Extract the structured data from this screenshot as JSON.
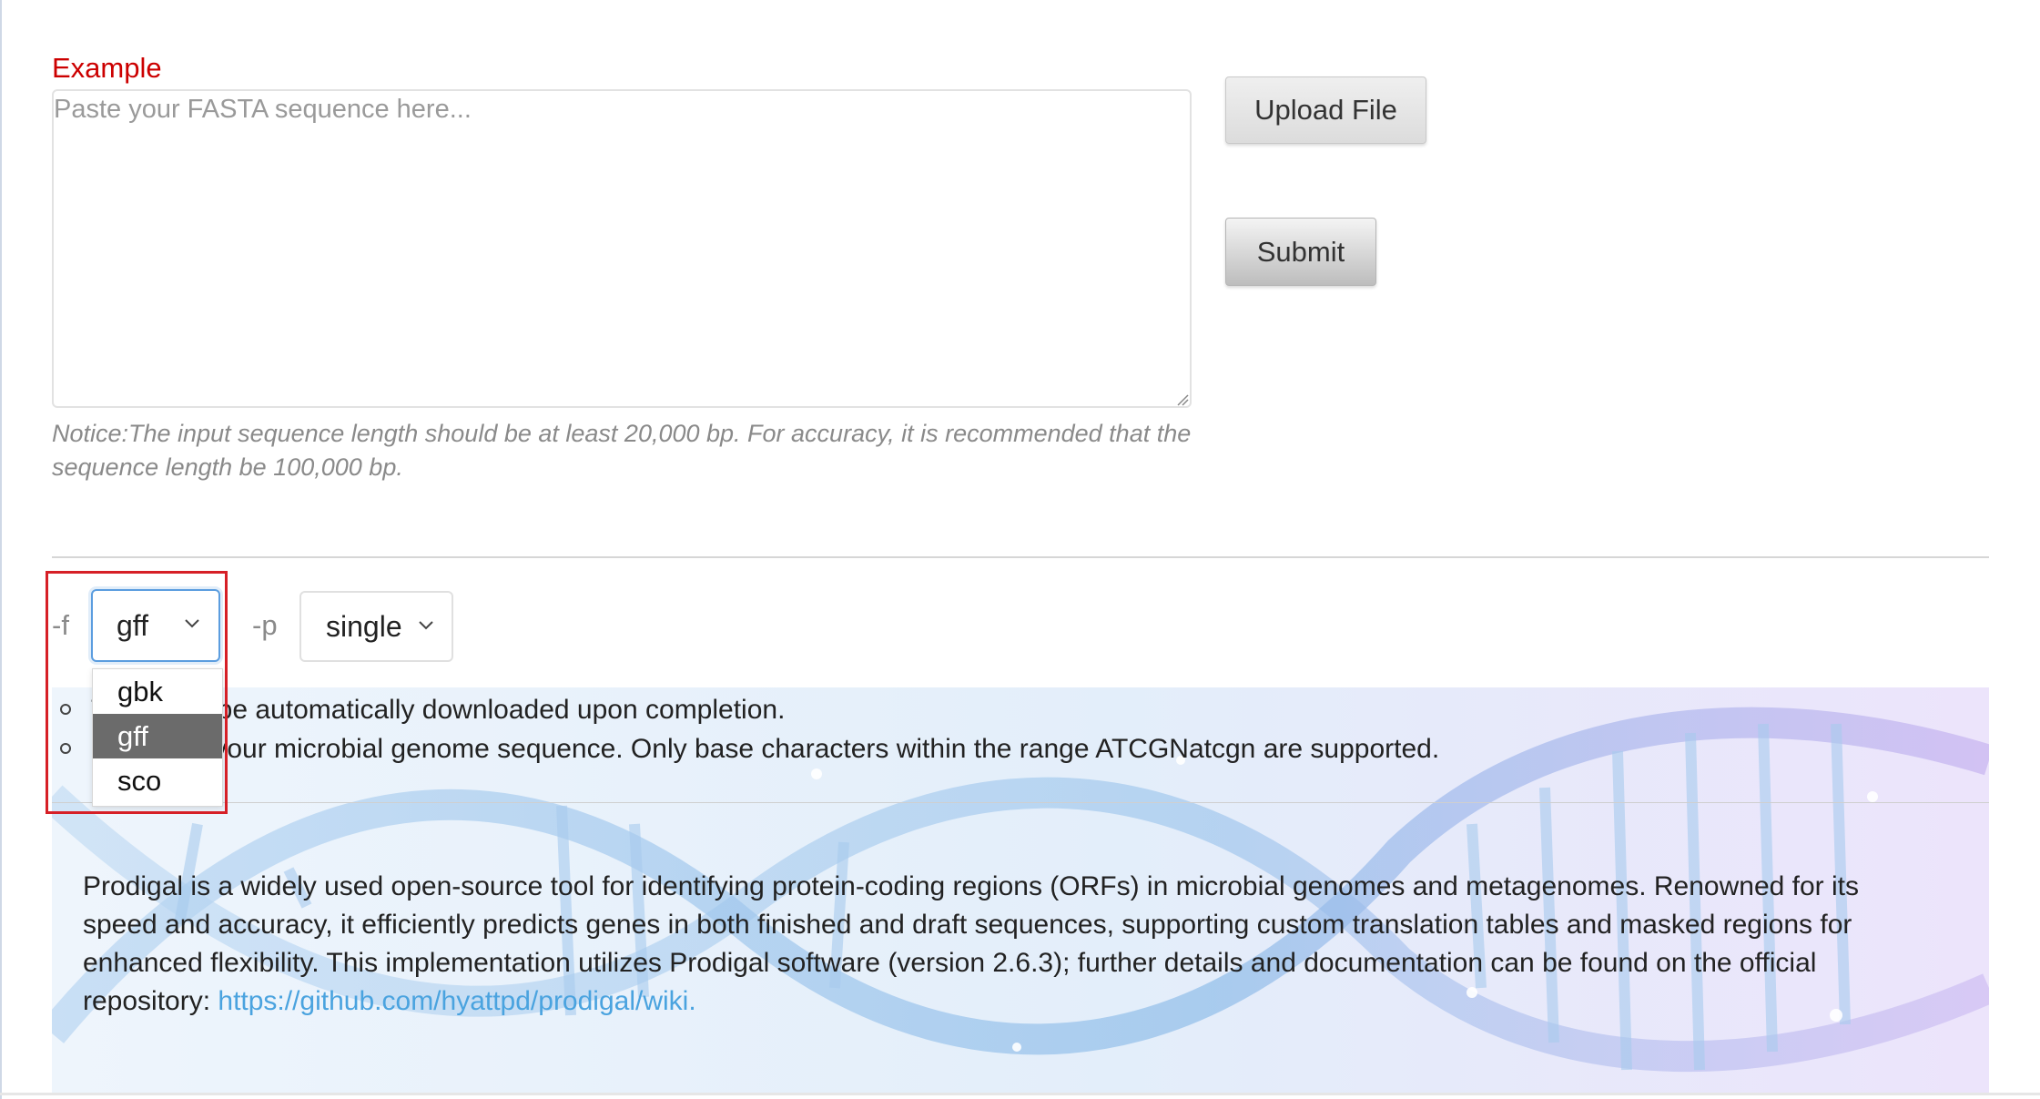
{
  "form": {
    "example_label": "Example",
    "textarea_placeholder": "Paste your FASTA sequence here...",
    "upload_label": "Upload File",
    "submit_label": "Submit",
    "notice_line1": "Notice:The input sequence length should be at least 20,000 bp. For accuracy, it is recommended that the",
    "notice_line2": "sequence length be 100,000 bp."
  },
  "options": {
    "f_label": "-f",
    "f_value": "gff",
    "f_options": [
      "gbk",
      "gff",
      "sco"
    ],
    "f_selected_index": 1,
    "p_label": "-p",
    "p_value": "single"
  },
  "bullets": {
    "b1_visible": "ile will be automatically downloaded upon completion.",
    "b2_visible": "r your microbial genome sequence. Only base characters within the range ATCGNatcgn are supported."
  },
  "description": {
    "text": "Prodigal is a widely used open-source tool for identifying protein-coding regions (ORFs) in microbial genomes and metagenomes. Renowned for its speed and accuracy, it efficiently predicts genes in both finished and draft sequences, supporting custom translation tables and masked regions for enhanced flexibility. This implementation utilizes Prodigal software (version 2.6.3); further details and documentation can be found on the official repository: ",
    "link_text": "https://github.com/hyattpd/prodigal/wiki."
  },
  "colors": {
    "example_red": "#cc0000",
    "highlight_red": "#d61f26",
    "link_blue": "#4aa3df",
    "selected_option_bg": "#6b6b6b",
    "focus_border": "#5b9ddf"
  }
}
